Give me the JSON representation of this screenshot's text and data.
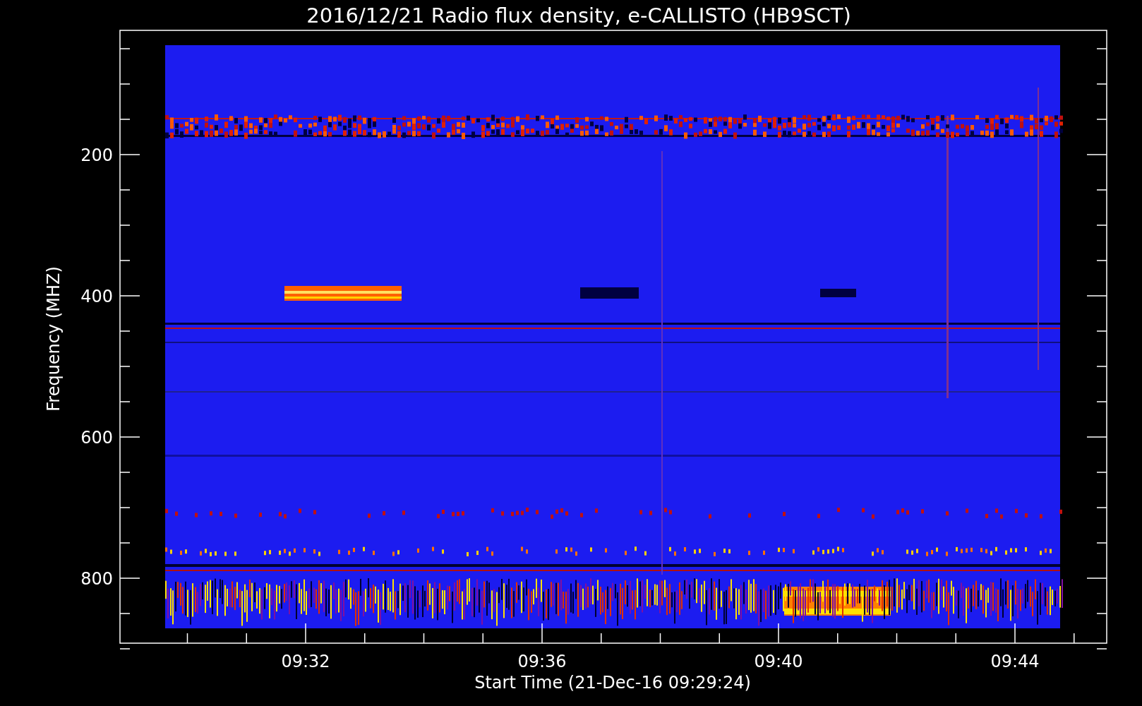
{
  "title": "2016/12/21  Radio flux density, e-CALLISTO (HB9SCT)",
  "y_axis": {
    "label": "Frequency (MHZ)",
    "ticks": [
      "200",
      "400",
      "600",
      "800"
    ]
  },
  "x_axis": {
    "label": "Start Time (21-Dec-16 09:29:24)",
    "ticks": [
      "09:32",
      "09:36",
      "09:40",
      "09:44"
    ]
  }
}
